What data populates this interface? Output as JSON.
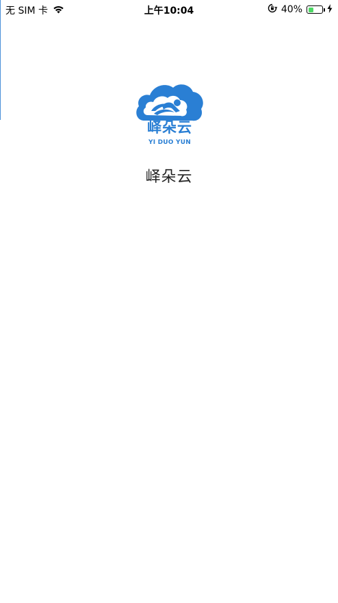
{
  "status_bar": {
    "carrier": "无 SIM 卡",
    "time": "上午10:04",
    "battery_percent": "40%",
    "battery_level": 0.4,
    "icons": [
      "wifi-icon",
      "orientation-lock-icon",
      "battery-icon",
      "charging-icon"
    ]
  },
  "logo": {
    "cn_text": "峄朵云",
    "en_text": "YI DUO YUN",
    "color": "#2a7fd4"
  },
  "splash": {
    "app_name": "峄朵云"
  }
}
